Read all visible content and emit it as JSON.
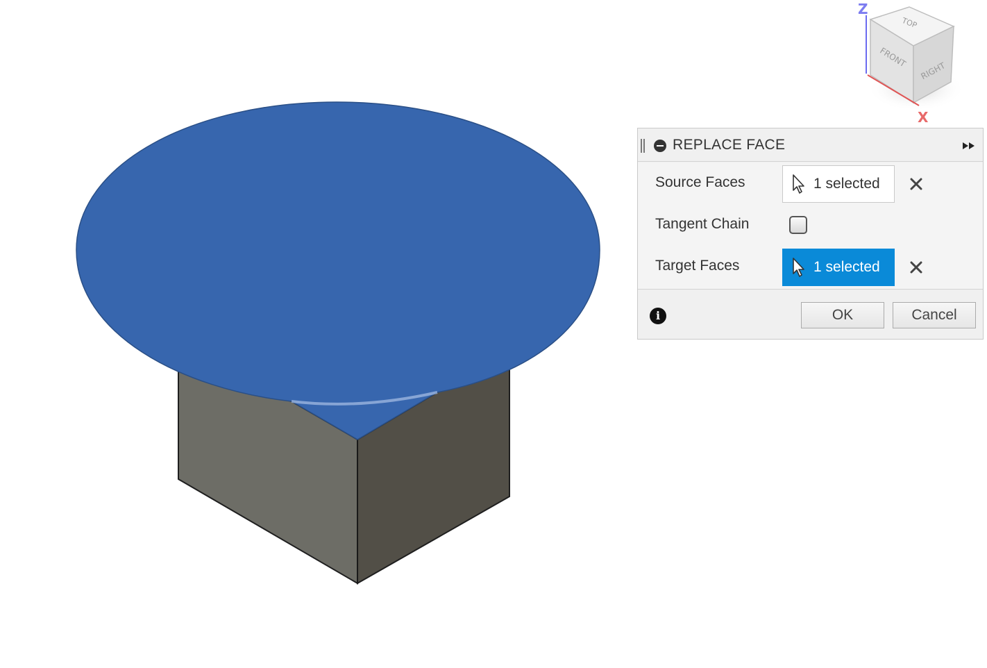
{
  "viewcube": {
    "axis_z": "Z",
    "axis_x": "X",
    "face_top": "TOP",
    "face_front": "FRONT",
    "face_right": "RIGHT"
  },
  "panel": {
    "title": "REPLACE FACE",
    "rows": {
      "source_faces": {
        "label": "Source Faces",
        "value": "1 selected",
        "active": false
      },
      "tangent_chain": {
        "label": "Tangent Chain",
        "checked": false
      },
      "target_faces": {
        "label": "Target Faces",
        "value": "1 selected",
        "active": true
      }
    },
    "ok_label": "OK",
    "cancel_label": "Cancel",
    "info_glyph": "i"
  },
  "colors": {
    "selection_face": "#3766ae",
    "active_select": "#0a8ad8",
    "box_left_face": "#6d6d66",
    "box_right_face": "#524f47"
  },
  "icons": [
    "grip-icon",
    "minus-circle-icon",
    "expand-icon",
    "cursor-icon",
    "close-icon",
    "info-icon"
  ]
}
